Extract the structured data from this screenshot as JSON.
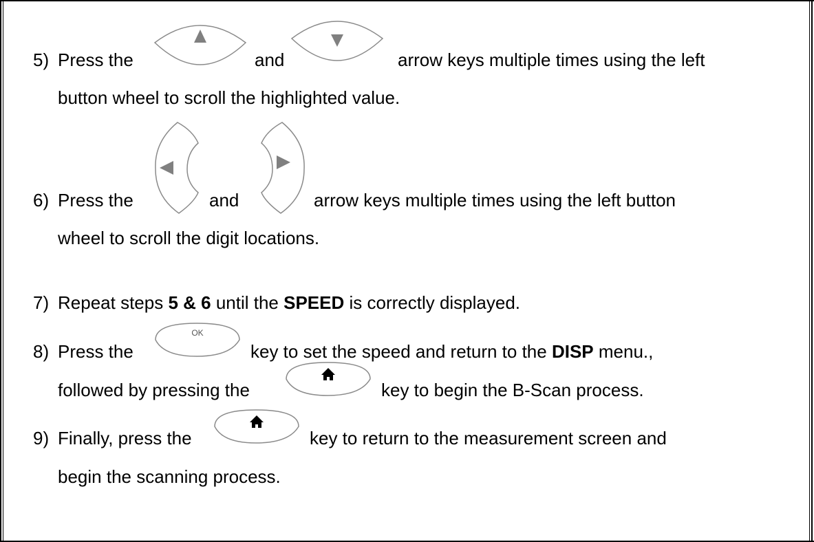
{
  "steps": [
    {
      "number": "5)",
      "line1": {
        "a": "Press the",
        "b": "and",
        "c": "arrow keys multiple times using the left"
      },
      "line2": "button wheel to scroll the highlighted value."
    },
    {
      "number": "6)",
      "line1": {
        "a": "Press the",
        "b": "and",
        "c": "arrow keys multiple times using the left button"
      },
      "line2": "wheel to scroll the digit locations."
    },
    {
      "number": "7)",
      "parts": [
        "Repeat steps ",
        "5 & 6",
        " until the ",
        "SPEED",
        " is correctly displayed."
      ]
    },
    {
      "number": "8)",
      "line1": {
        "a": "Press the",
        "c": "key to set the speed and return to the ",
        "bold": "DISP",
        "d": " menu.,"
      },
      "line2": {
        "a": "followed by pressing the",
        "c": "key to begin the B-Scan process."
      }
    },
    {
      "number": "9)",
      "line1": {
        "a": "Finally, press the",
        "c": "key to return to the measurement screen and"
      },
      "line2": "begin the scanning process."
    }
  ],
  "keys": {
    "ok_label": "OK"
  },
  "icons": [
    "up-arrow-key-icon",
    "down-arrow-key-icon",
    "left-arrow-key-icon",
    "right-arrow-key-icon",
    "ok-key-icon",
    "home-key-icon"
  ]
}
